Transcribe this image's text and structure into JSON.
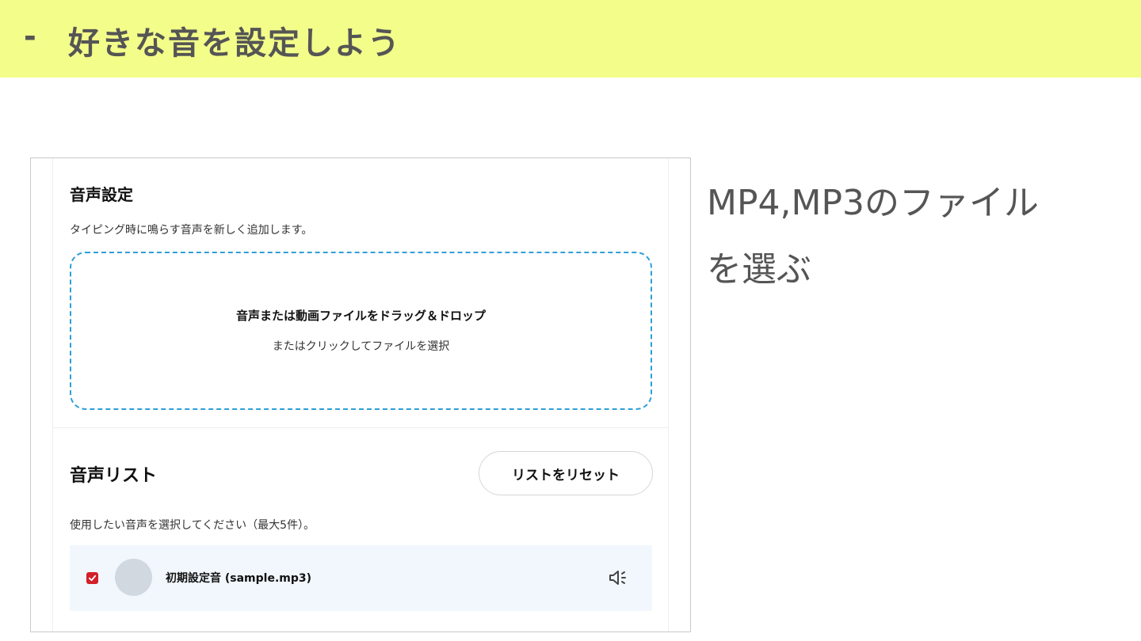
{
  "banner": {
    "dash": "-",
    "title": "好きな音を設定しよう"
  },
  "audio_settings": {
    "title": "音声設定",
    "description": "タイピング時に鳴らす音声を新しく追加します。",
    "dropzone_main": "音声または動画ファイルをドラッグ＆ドロップ",
    "dropzone_sub": "またはクリックしてファイルを選択"
  },
  "audio_list": {
    "title": "音声リスト",
    "reset_button": "リストをリセット",
    "description": "使用したい音声を選択してください（最大5件）。",
    "items": [
      {
        "name": "初期設定音 (sample.mp3)",
        "checked": true
      }
    ]
  },
  "instruction": {
    "line1": "MP4,MP3のファイル",
    "line2": "を選ぶ"
  },
  "colors": {
    "banner_bg": "#f3fd89",
    "dropzone_border": "#2d9fd9",
    "checkbox": "#d3202a",
    "row_bg": "#f1f7fc"
  },
  "icons": [
    "checkmark-icon",
    "speaker-icon"
  ]
}
